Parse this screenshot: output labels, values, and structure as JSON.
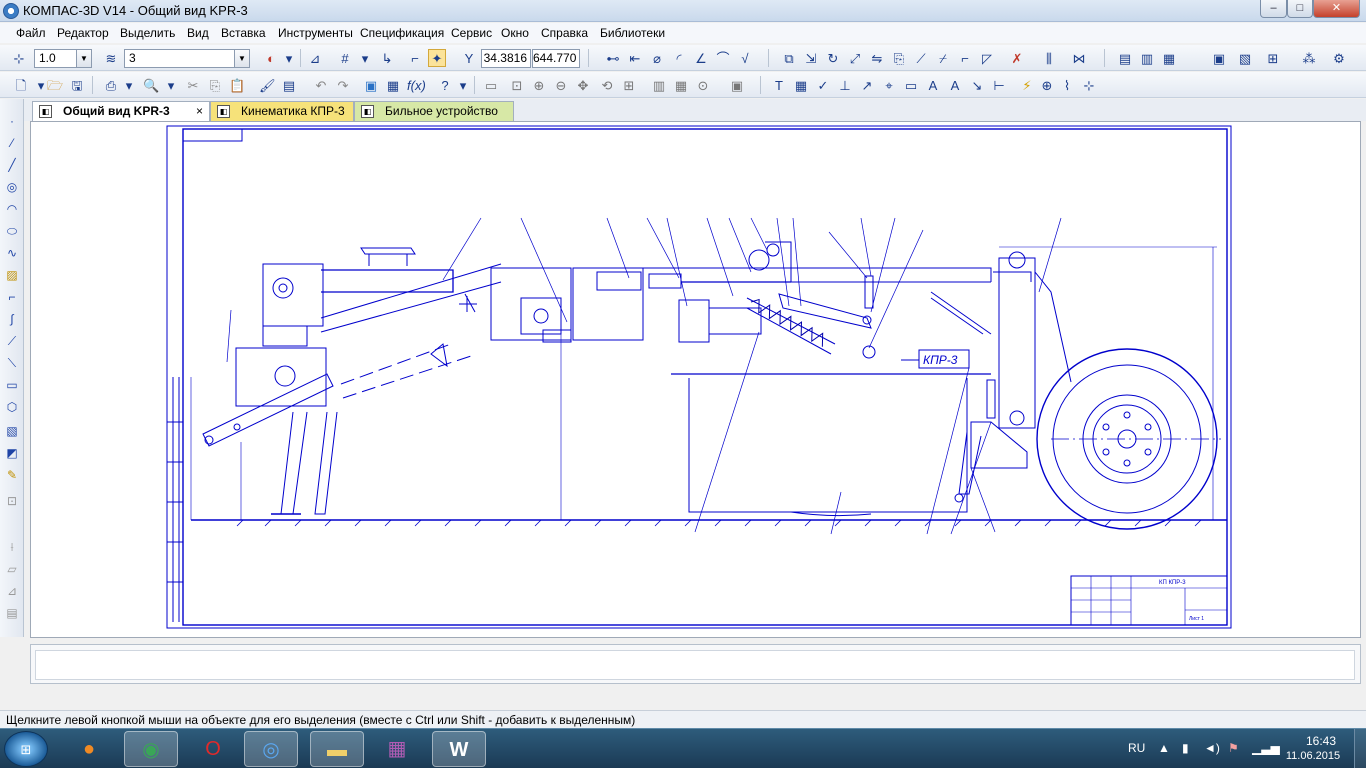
{
  "window": {
    "title": "КОМПАС-3D V14 - Общий вид KPR-3",
    "minimize": "–",
    "maximize": "□",
    "close": "✕"
  },
  "menu": {
    "items": [
      "Файл",
      "Редактор",
      "Выделить",
      "Вид",
      "Вставка",
      "Инструменты",
      "Спецификация",
      "Сервис",
      "Окно",
      "Справка",
      "Библиотеки"
    ]
  },
  "toolbar1": {
    "scale_value": "1.0",
    "layer_value": "3",
    "coord_x": "34.3816",
    "coord_y": "644.770"
  },
  "tabs": [
    {
      "label": "Общий вид KPR-3",
      "active": true,
      "close": "×"
    },
    {
      "label": "Кинематика КПР-3",
      "active": false
    },
    {
      "label": "Бильное устройство",
      "active": false
    }
  ],
  "drawing": {
    "stamp_label": "КПР-3",
    "title_code": "КП КПР-3",
    "title_sheet": "Лист 1"
  },
  "status": {
    "text": "Щелкните левой кнопкой мыши на объекте для его выделения (вместе с Ctrl или Shift - добавить к выделенным)"
  },
  "taskbar": {
    "apps": [
      {
        "name": "firefox",
        "icon": "firefox-icon",
        "color": "#e8721f"
      },
      {
        "name": "chrome",
        "icon": "chrome-icon",
        "color": "#3aa657"
      },
      {
        "name": "opera",
        "icon": "opera-icon",
        "color": "#cc1b1b"
      },
      {
        "name": "kompas",
        "icon": "kompas-icon",
        "color": "#2a72c6"
      },
      {
        "name": "explorer",
        "icon": "folder-icon",
        "color": "#e3c25b"
      },
      {
        "name": "winrar",
        "icon": "winrar-icon",
        "color": "#8b3c8c"
      },
      {
        "name": "word",
        "icon": "word-icon",
        "color": "#2b5aa8"
      }
    ],
    "lang": "RU",
    "time": "16:43",
    "date": "11.06.2015"
  },
  "colors": {
    "drawing_line": "#0000cc",
    "canvas_bg": "#ffffff"
  }
}
